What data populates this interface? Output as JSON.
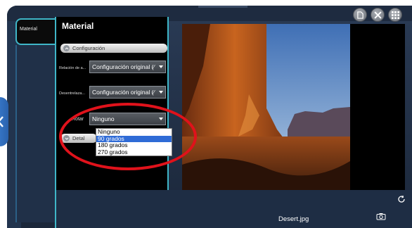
{
  "tab": {
    "label": "Material"
  },
  "panel": {
    "title": "Material",
    "section_config": "Configuración",
    "rows": [
      {
        "label": "Relación de a...",
        "value": "Configuración original (∕"
      },
      {
        "label": "Desentrelaza...",
        "value": "Configuración original (∕"
      },
      {
        "label": "Rotar",
        "value": "Ninguno"
      }
    ],
    "section_details": "Detal"
  },
  "rotate_dropdown": {
    "options": [
      "Ninguno",
      "90 grados",
      "180 grados",
      "270 grados"
    ],
    "highlighted": "90 grados"
  },
  "viewer": {
    "filename": "Desert.jpg"
  },
  "icons": {
    "new": "document-icon",
    "close": "close-icon",
    "grid": "grid-icon",
    "back": "chevron-left-icon",
    "camera": "camera-icon",
    "rotate": "refresh-icon"
  },
  "colors": {
    "accent": "#3fb6c8",
    "highlight": "#2f6bd6",
    "annotation": "#e0121b"
  }
}
